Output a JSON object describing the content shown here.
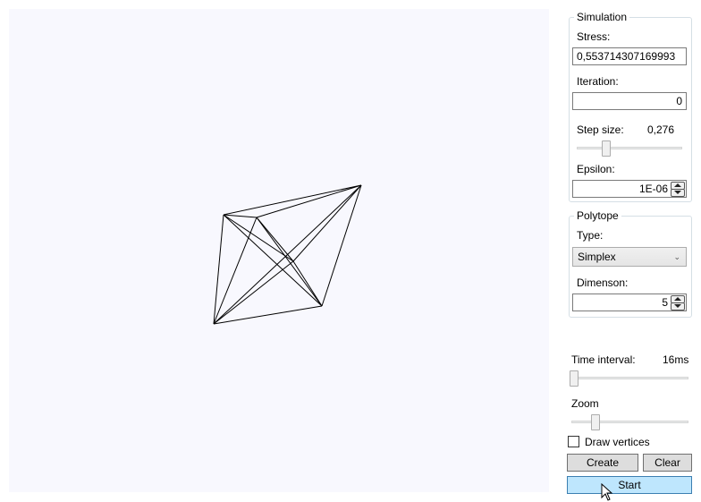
{
  "simulation": {
    "title": "Simulation",
    "stress_label": "Stress:",
    "stress_value": "0,553714307169993",
    "iteration_label": "Iteration:",
    "iteration_value": "0",
    "step_size_label": "Step size:",
    "step_size_value": "0,276",
    "step_size_slider": 0.276,
    "epsilon_label": "Epsilon:",
    "epsilon_value": "1E-06"
  },
  "polytope": {
    "title": "Polytope",
    "type_label": "Type:",
    "type_value": "Simplex",
    "dimension_label": "Dimenson:",
    "dimension_value": "5"
  },
  "time_interval": {
    "label": "Time interval:",
    "value": "16ms",
    "slider": 0.0
  },
  "zoom": {
    "label": "Zoom",
    "slider": 0.2
  },
  "draw_vertices": {
    "label": "Draw vertices",
    "checked": false
  },
  "buttons": {
    "create": "Create",
    "clear": "Clear",
    "start": "Start"
  },
  "colors": {
    "canvas_bg": "#f8f8fe",
    "edge": "#000000",
    "start_button_bg": "#bee6fd"
  }
}
